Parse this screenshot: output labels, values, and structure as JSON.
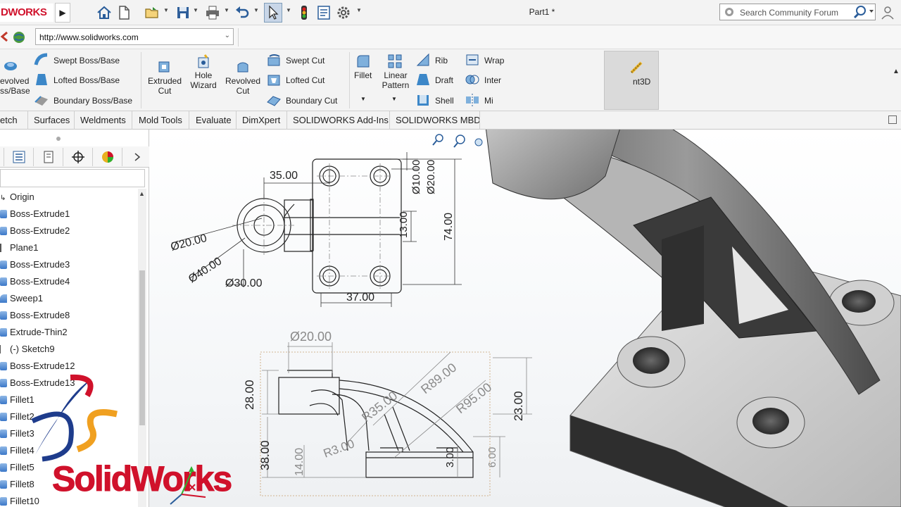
{
  "titlebar": {
    "logo": "DWORKS",
    "logo_arrow": "▶",
    "window_title": "Part1 *",
    "search_placeholder": "Search Community Forum"
  },
  "addressbar": {
    "url": "http://www.solidworks.com"
  },
  "ribbon": {
    "revolved_boss": "evolved\nss/Base",
    "swept_boss": "Swept Boss/Base",
    "lofted_boss": "Lofted Boss/Base",
    "boundary_boss": "Boundary Boss/Base",
    "extruded_cut": "Extruded\nCut",
    "hole_wizard": "Hole\nWizard",
    "revolved_cut": "Revolved\nCut",
    "swept_cut": "Swept Cut",
    "lofted_cut": "Lofted Cut",
    "boundary_cut": "Boundary Cut",
    "fillet": "Fillet",
    "linear_pattern": "Linear\nPattern",
    "rib": "Rib",
    "draft": "Draft",
    "shell": "Shell",
    "wrap": "Wrap",
    "intersect": "Inter",
    "mirror": "Mi",
    "instant3d": "nt3D"
  },
  "tabs": [
    "etch",
    "Surfaces",
    "Weldments",
    "Mold Tools",
    "Evaluate",
    "DimXpert",
    "SOLIDWORKS Add-Ins",
    "SOLIDWORKS MBD"
  ],
  "tree": [
    "Origin",
    "Boss-Extrude1",
    "Boss-Extrude2",
    "Plane1",
    "Boss-Extrude3",
    "Boss-Extrude4",
    "Sweep1",
    "Boss-Extrude8",
    "Extrude-Thin2",
    "(-) Sketch9",
    "Boss-Extrude12",
    "Boss-Extrude13",
    "Fillet1",
    "Fillet2",
    "Fillet3",
    "Fillet4",
    "Fillet5",
    "Fillet8",
    "Fillet10"
  ],
  "top_view_dims": {
    "w35": "35.00",
    "d10": "Ø10.00",
    "d20a": "Ø20.00",
    "h74": "74.00",
    "h13": "13.00",
    "d20b": "Ø20.00",
    "d40": "Ø40.00",
    "d30": "Ø30.00",
    "w37": "37.00"
  },
  "front_view_dims": {
    "d20": "Ø20.00",
    "r89": "R89.00",
    "r95": "R95.00",
    "r35": "R35.00",
    "h28": "28.00",
    "h23": "23.00",
    "h38": "38.00",
    "h14": "14.00",
    "r3": "R3.00",
    "h3": "3.00",
    "h6": "6.00"
  },
  "watermark": {
    "brand": "SolidWorks"
  },
  "colors": {
    "brand_red": "#d0112b",
    "ds_blue": "#1e3c8c",
    "ds_orange": "#f0a020"
  }
}
